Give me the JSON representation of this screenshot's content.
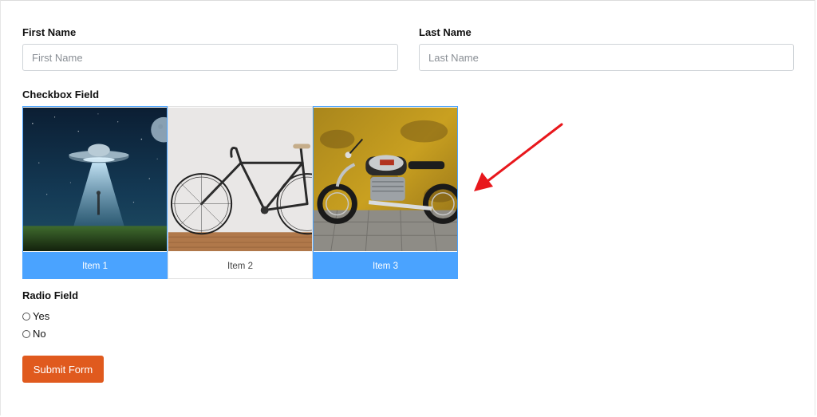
{
  "form": {
    "first_name": {
      "label": "First Name",
      "placeholder": "First Name",
      "value": ""
    },
    "last_name": {
      "label": "Last Name",
      "placeholder": "Last Name",
      "value": ""
    },
    "checkbox_field": {
      "label": "Checkbox Field",
      "items": [
        {
          "label": "Item 1",
          "selected": true,
          "image": "ufo-night-sky"
        },
        {
          "label": "Item 2",
          "selected": false,
          "image": "bicycle-white-wall"
        },
        {
          "label": "Item 3",
          "selected": true,
          "image": "motorcycle-yellow-wall"
        }
      ]
    },
    "radio_field": {
      "label": "Radio Field",
      "options": [
        {
          "label": "Yes",
          "checked": false
        },
        {
          "label": "No",
          "checked": false
        }
      ]
    },
    "submit_label": "Submit Form"
  },
  "colors": {
    "selected_accent": "#4aa3ff",
    "submit_button": "#e05a1e",
    "annotation_arrow": "#e8171c"
  },
  "icons": {
    "annotation": "red-arrow-icon"
  }
}
